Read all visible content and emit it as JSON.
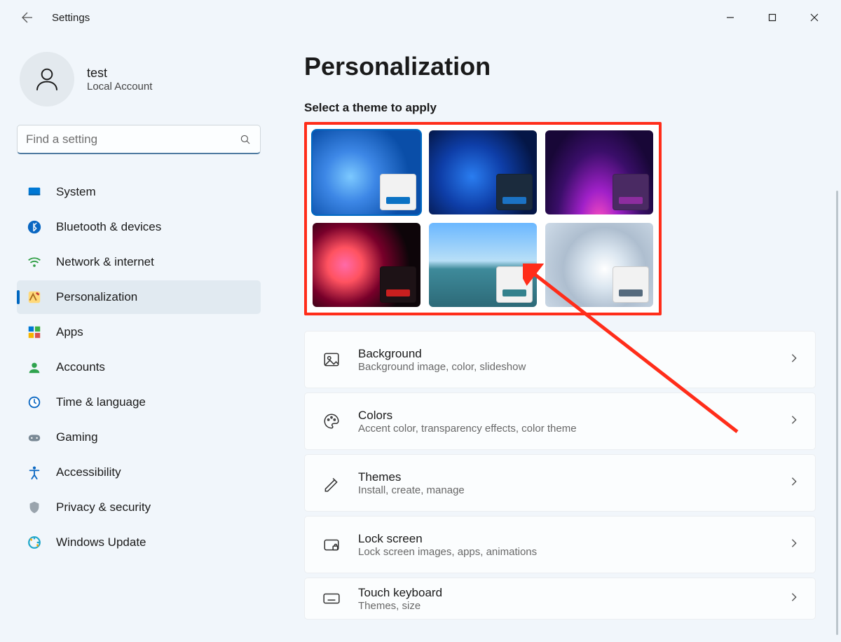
{
  "app_title": "Settings",
  "profile": {
    "name": "test",
    "sub": "Local Account"
  },
  "search": {
    "placeholder": "Find a setting"
  },
  "nav": [
    {
      "icon": "system",
      "label": "System"
    },
    {
      "icon": "bluetooth",
      "label": "Bluetooth & devices"
    },
    {
      "icon": "network",
      "label": "Network & internet"
    },
    {
      "icon": "personalization",
      "label": "Personalization",
      "active": true
    },
    {
      "icon": "apps",
      "label": "Apps"
    },
    {
      "icon": "accounts",
      "label": "Accounts"
    },
    {
      "icon": "time",
      "label": "Time & language"
    },
    {
      "icon": "gaming",
      "label": "Gaming"
    },
    {
      "icon": "accessibility",
      "label": "Accessibility"
    },
    {
      "icon": "privacy",
      "label": "Privacy & security"
    },
    {
      "icon": "update",
      "label": "Windows Update"
    }
  ],
  "page": {
    "title": "Personalization",
    "theme_label": "Select a theme to apply",
    "themes": [
      {
        "bg_style": "radial-gradient(circle at 35% 55%, #7cc9ff 0%, #3d87e6 30%, #0a4ea8 70%)",
        "swatch_bg": "#f2f2f2",
        "swatch_accent": "#0b72c4",
        "selected": true
      },
      {
        "bg_style": "radial-gradient(circle at 40% 55%, #2a7df0 0%, #0e3ea8 40%, #041646 80%)",
        "swatch_bg": "#1b2b3d",
        "swatch_accent": "#1b72c4"
      },
      {
        "bg_style": "radial-gradient(ellipse at 50% 110%, #ff4fbf 0%, #a020c8 25%, #3a0e69 55%, #180737 80%)",
        "swatch_bg": "#4a2a63",
        "swatch_accent": "#8d2d9f"
      },
      {
        "bg_style": "radial-gradient(circle at 30% 50%, #ff6aa8 0%, #ff5260 20%, #78002a 45%, #0d0509 75%)",
        "swatch_bg": "#1d1216",
        "swatch_accent": "#c91f1f"
      },
      {
        "bg_style": "linear-gradient(to bottom, #6ab7ff 0%, #b8dff7 45%, #3e8a9a 55%, #2d6a78 100%)",
        "swatch_bg": "#f2f2f2",
        "swatch_accent": "#33818d"
      },
      {
        "bg_style": "radial-gradient(circle at 55% 55%, #ffffff 0%, #dbe6f0 25%, #aebecf 55%, #cedbe8 100%)",
        "swatch_bg": "#f2f2f2",
        "swatch_accent": "#556a7d"
      }
    ],
    "rows": [
      {
        "icon": "background",
        "title": "Background",
        "sub": "Background image, color, slideshow"
      },
      {
        "icon": "colors",
        "title": "Colors",
        "sub": "Accent color, transparency effects, color theme"
      },
      {
        "icon": "themes",
        "title": "Themes",
        "sub": "Install, create, manage"
      },
      {
        "icon": "lock",
        "title": "Lock screen",
        "sub": "Lock screen images, apps, animations"
      },
      {
        "icon": "keyboard",
        "title": "Touch keyboard",
        "sub": "Themes, size"
      }
    ]
  }
}
